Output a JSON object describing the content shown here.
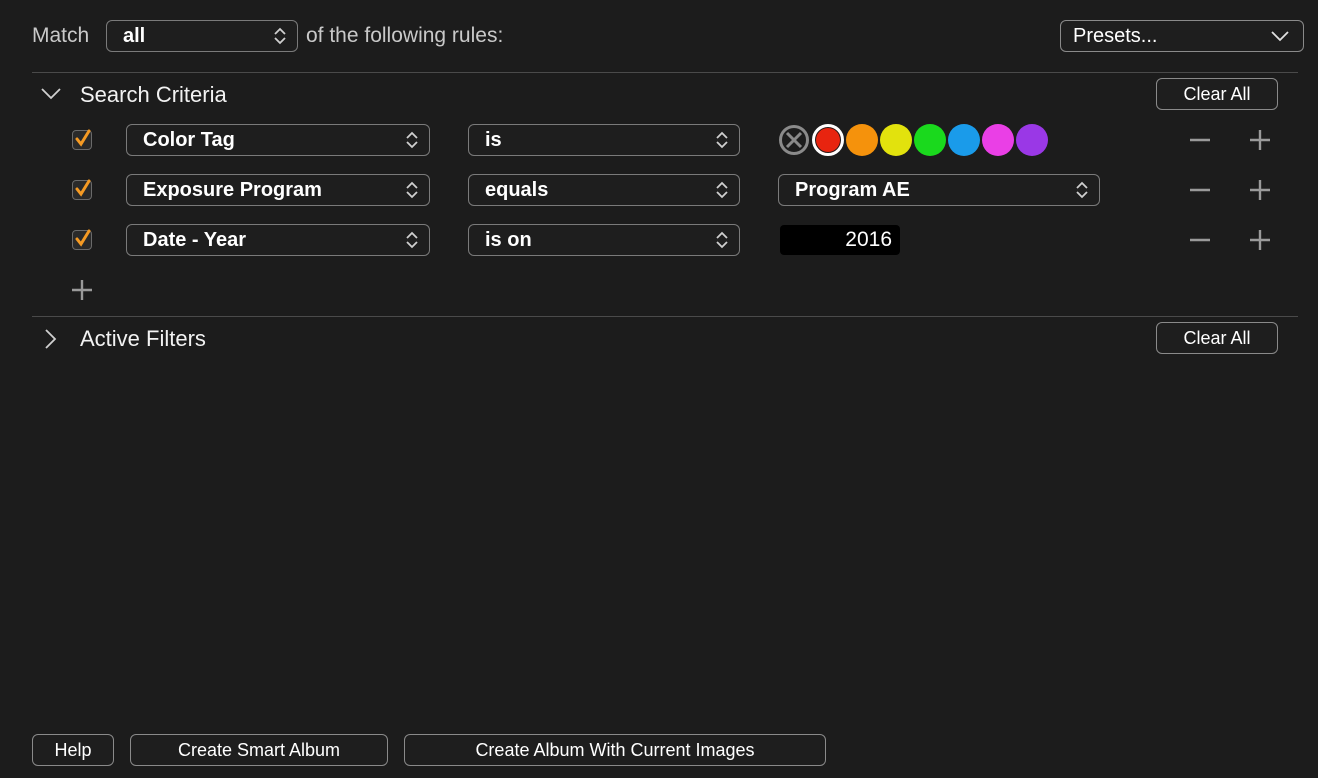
{
  "header": {
    "match_label": "Match",
    "match_value": "all",
    "rules_label": "of the following rules:",
    "presets_label": "Presets..."
  },
  "search_criteria": {
    "title": "Search Criteria",
    "clear_all_label": "Clear All",
    "rules": [
      {
        "checked": true,
        "field": "Color Tag",
        "operator": "is",
        "value_type": "color-tags"
      },
      {
        "checked": true,
        "field": "Exposure Program",
        "operator": "equals",
        "value": "Program AE"
      },
      {
        "checked": true,
        "field": "Date - Year",
        "operator": "is on",
        "value": "2016"
      }
    ],
    "color_tags": {
      "none": "#8a8a8a",
      "colors": [
        "#e8240f",
        "#f5920c",
        "#e2e20d",
        "#1ad91d",
        "#1a9bea",
        "#ea3fe6",
        "#9a38e6"
      ],
      "selected": "red"
    }
  },
  "active_filters": {
    "title": "Active Filters",
    "clear_all_label": "Clear All"
  },
  "footer": {
    "help_label": "Help",
    "create_smart_album_label": "Create Smart Album",
    "create_album_current_label": "Create Album With Current Images"
  },
  "colors": {
    "background": "#1c1c1c",
    "checkbox_accent": "#f59a23",
    "border": "#7a7a7a"
  }
}
